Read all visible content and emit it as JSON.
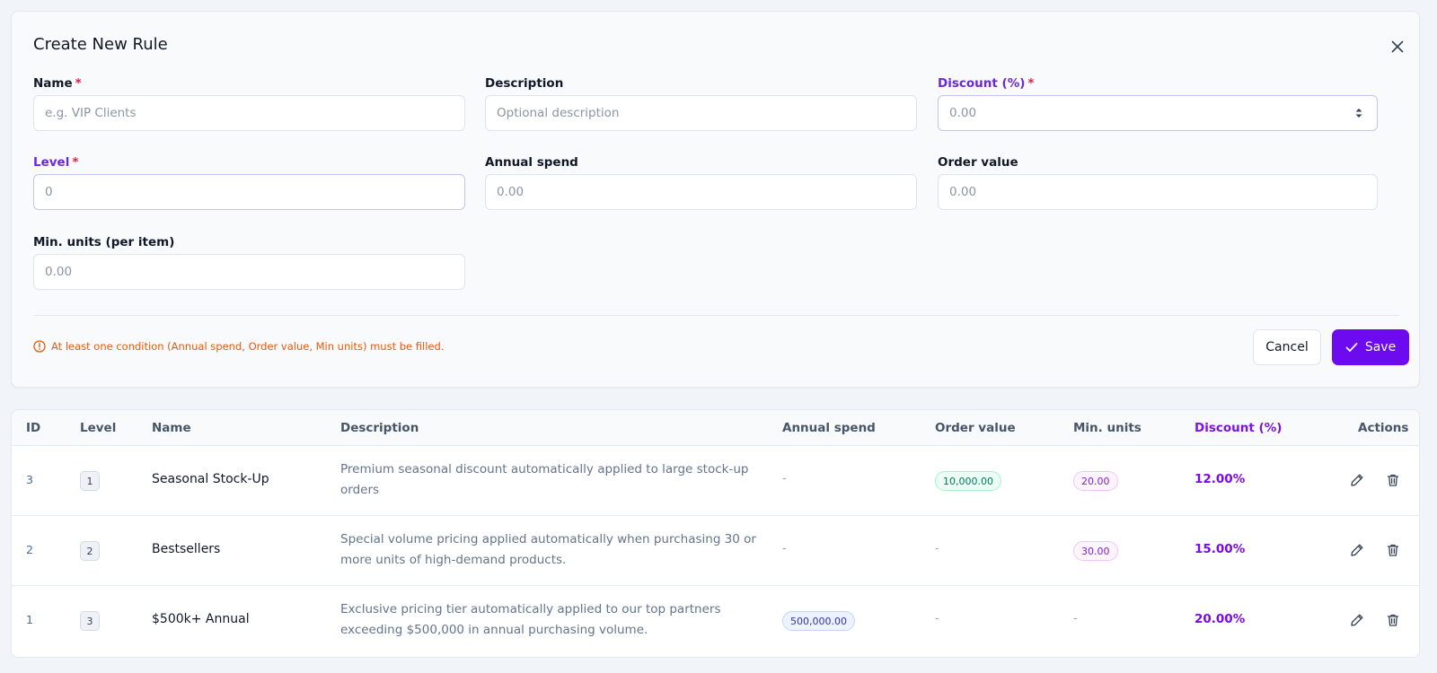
{
  "form": {
    "title": "Create New Rule",
    "fields": {
      "name": {
        "label": "Name",
        "required": "*",
        "placeholder": "e.g. VIP Clients",
        "value": ""
      },
      "description": {
        "label": "Description",
        "placeholder": "Optional description",
        "value": ""
      },
      "discount": {
        "label": "Discount (%)",
        "required": "*",
        "placeholder": "0.00",
        "value": ""
      },
      "level": {
        "label": "Level",
        "required": "*",
        "placeholder": "0",
        "value": ""
      },
      "annual_spend": {
        "label": "Annual spend",
        "placeholder": "0.00",
        "value": ""
      },
      "order_value": {
        "label": "Order value",
        "placeholder": "0.00",
        "value": ""
      },
      "min_units": {
        "label": "Min. units (per item)",
        "placeholder": "0.00",
        "value": ""
      }
    },
    "warning": "At least one condition (Annual spend, Order value, Min units) must be filled.",
    "cancel_label": "Cancel",
    "save_label": "Save"
  },
  "table": {
    "headers": {
      "id": "ID",
      "level": "Level",
      "name": "Name",
      "description": "Description",
      "annual_spend": "Annual spend",
      "order_value": "Order value",
      "min_units": "Min. units",
      "discount": "Discount (%)",
      "actions": "Actions"
    },
    "rows": [
      {
        "id": "3",
        "level": "1",
        "name": "Seasonal Stock-Up",
        "description": "Premium seasonal discount automatically applied to large stock-up orders",
        "annual_spend": "-",
        "order_value": "10,000.00",
        "min_units": "20.00",
        "discount": "12.00%"
      },
      {
        "id": "2",
        "level": "2",
        "name": "Bestsellers",
        "description": "Special volume pricing applied automatically when purchasing 30 or more units of high-demand products.",
        "annual_spend": "-",
        "order_value": "-",
        "min_units": "30.00",
        "discount": "15.00%"
      },
      {
        "id": "1",
        "level": "3",
        "name": "$500k+ Annual",
        "description": "Exclusive pricing tier automatically applied to our top partners exceeding $500,000 in annual purchasing volume.",
        "annual_spend": "500,000.00",
        "order_value": "-",
        "min_units": "-",
        "discount": "20.00%"
      }
    ]
  },
  "colors": {
    "accent": "#6d0af0",
    "warning": "#ea580c",
    "required": "#e11d48"
  },
  "icons": [
    "close-icon",
    "spinner-arrows-icon",
    "alert-circle-icon",
    "check-icon",
    "pencil-icon",
    "trash-icon"
  ]
}
